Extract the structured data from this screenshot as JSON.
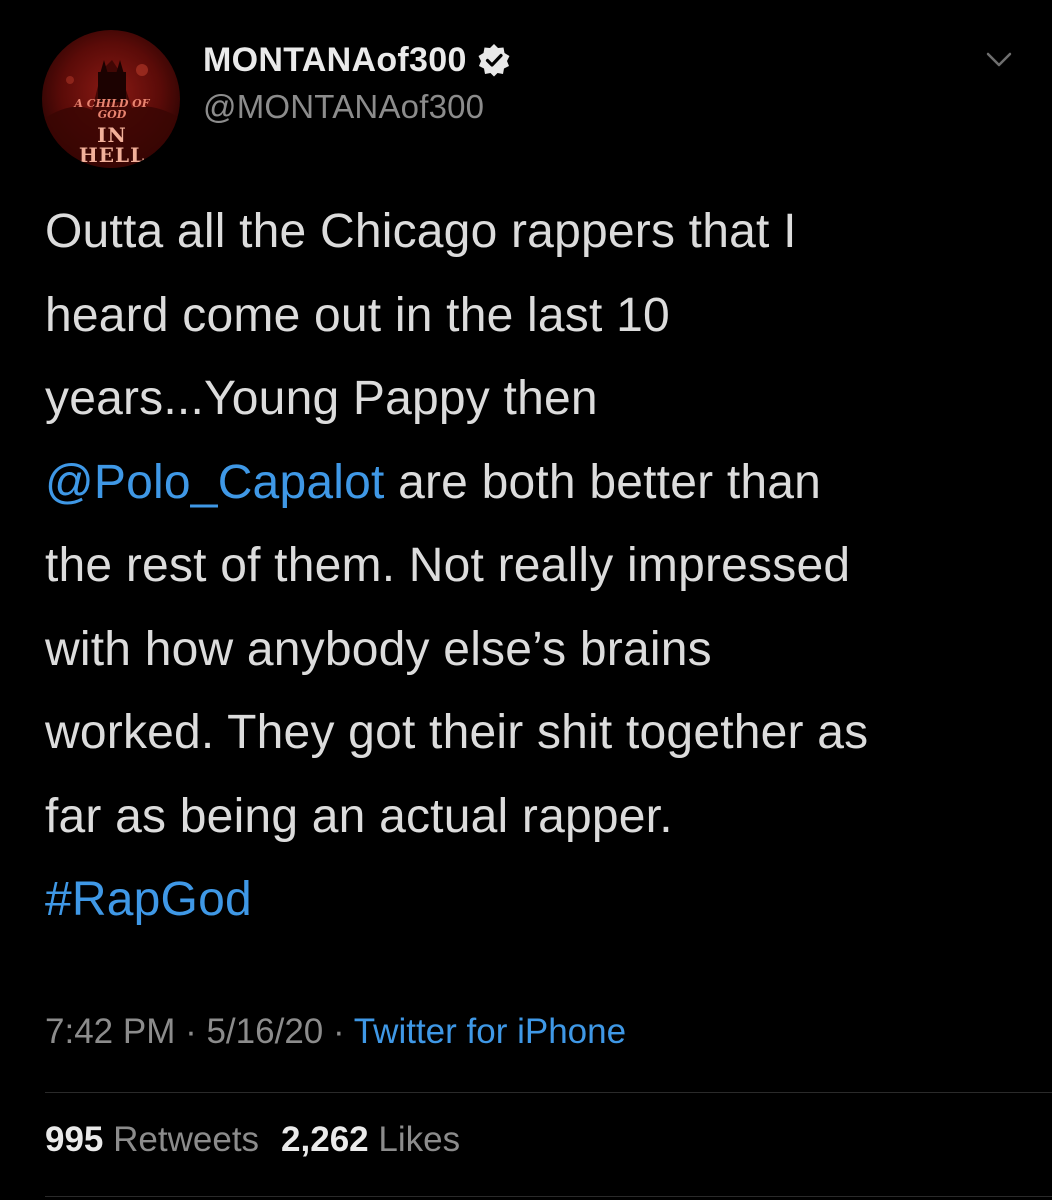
{
  "user": {
    "display_name": "MONTANAof300",
    "handle": "@MONTANAof300",
    "avatar_text_top": "A CHILD OF GOD",
    "avatar_text_main": "IN HELL",
    "verified_icon": "verified-badge-icon"
  },
  "menu": {
    "icon": "chevron-down-icon"
  },
  "tweet": {
    "lines": {
      "l1": "Outta all the Chicago rappers that I",
      "l2": "heard come out in the last 10",
      "l3": "years...Young Pappy then",
      "l4_mention": "@Polo_Capalot",
      "l4_rest": " are both better than",
      "l5": "the rest of them. Not really impressed",
      "l6": "with how anybody else’s brains",
      "l7": "worked. They got their shit together as",
      "l8": "far as being an actual rapper.",
      "l9_hashtag": "#RapGod"
    }
  },
  "meta": {
    "time": "7:42 PM",
    "separator": " · ",
    "date": "5/16/20",
    "source": "Twitter for iPhone"
  },
  "stats": {
    "retweets_count": "995",
    "retweets_label": "Retweets",
    "likes_count": "2,262",
    "likes_label": "Likes"
  },
  "colors": {
    "background": "#000000",
    "link": "#3f98e6",
    "secondary_text": "#8c8c8c",
    "primary_text": "#dcdcdc"
  }
}
